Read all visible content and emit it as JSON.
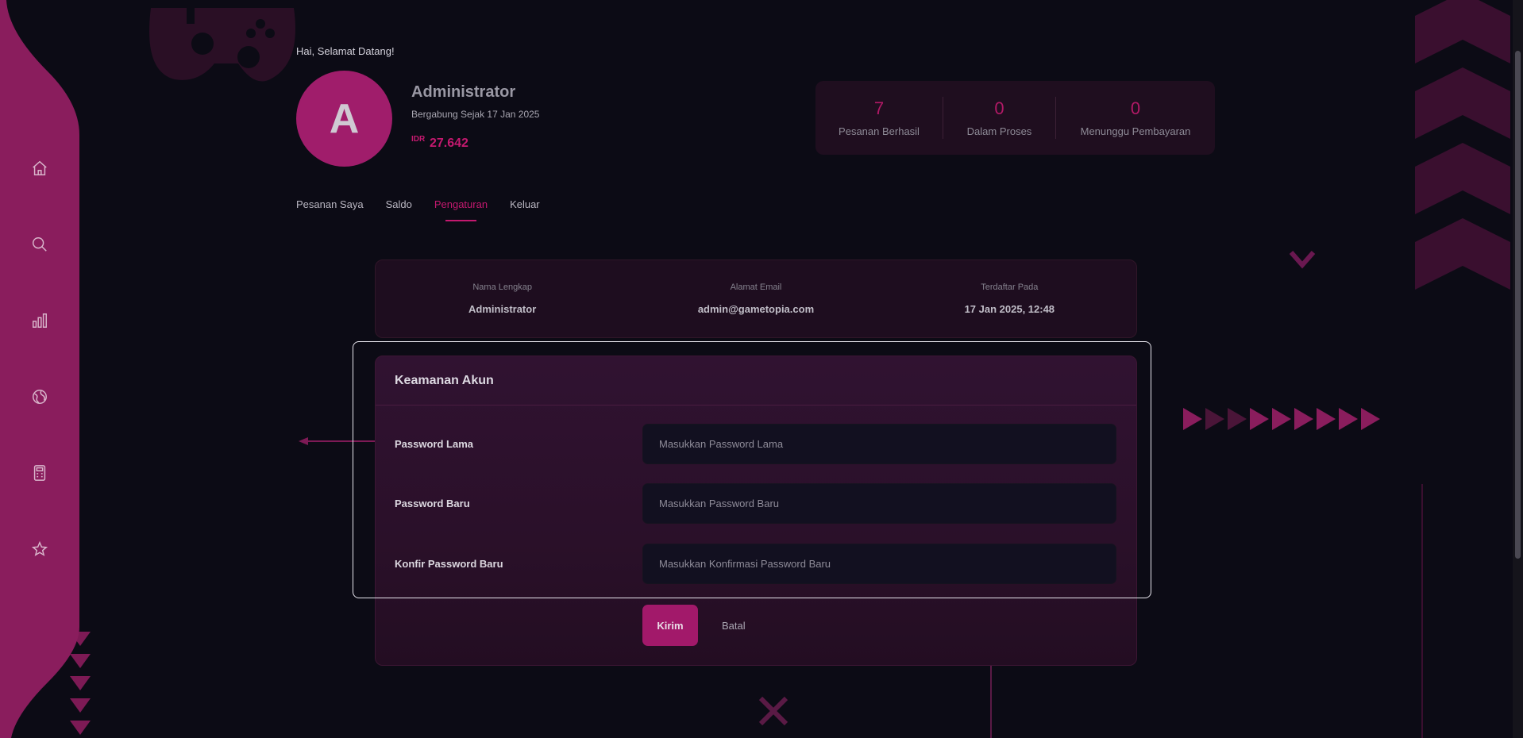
{
  "theme": {
    "accent": "#c4196f",
    "sidebar": "#8a1d5d",
    "background": "#0c0b15"
  },
  "sidebar": {
    "items": [
      {
        "icon": "home-icon"
      },
      {
        "icon": "search-icon"
      },
      {
        "icon": "bar-chart-icon"
      },
      {
        "icon": "globe-icon"
      },
      {
        "icon": "calculator-icon"
      },
      {
        "icon": "star-icon"
      }
    ]
  },
  "header": {
    "greeting": "Hai, Selamat Datang!",
    "avatar_initial": "A",
    "name": "Administrator",
    "joined": "Bergabung Sejak 17 Jan 2025",
    "balance_currency": "IDR",
    "balance_value": "27.642"
  },
  "stats": [
    {
      "value": "7",
      "label": "Pesanan Berhasil"
    },
    {
      "value": "0",
      "label": "Dalam Proses"
    },
    {
      "value": "0",
      "label": "Menunggu Pembayaran"
    }
  ],
  "tabs": [
    {
      "label": "Pesanan Saya"
    },
    {
      "label": "Saldo"
    },
    {
      "label": "Pengaturan",
      "active": true
    },
    {
      "label": "Keluar"
    }
  ],
  "profile_info": [
    {
      "key": "Nama Lengkap",
      "value": "Administrator"
    },
    {
      "key": "Alamat Email",
      "value": "admin@gametopia.com"
    },
    {
      "key": "Terdaftar Pada",
      "value": "17 Jan 2025, 12:48"
    }
  ],
  "security": {
    "title": "Keamanan Akun",
    "fields": [
      {
        "label": "Password Lama",
        "value": "",
        "placeholder": "Masukkan Password Lama"
      },
      {
        "label": "Password Baru",
        "value": "",
        "placeholder": "Masukkan Password Baru"
      },
      {
        "label": "Konfir Password Baru",
        "value": "",
        "placeholder": "Masukkan Konfirmasi Password Baru"
      }
    ],
    "submit_label": "Kirim",
    "cancel_label": "Batal"
  }
}
